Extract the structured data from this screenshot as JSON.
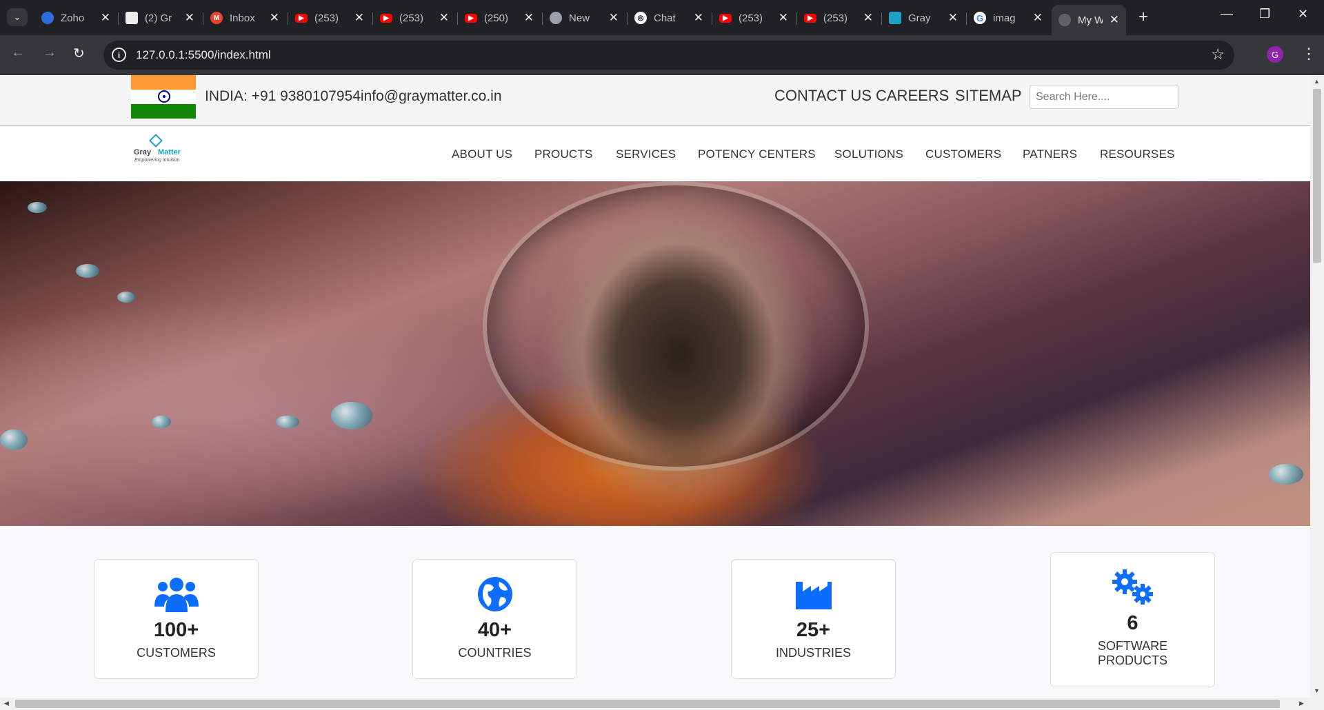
{
  "browser": {
    "tabs": [
      {
        "title": "Zoho",
        "fav_color": "#2d6cdf",
        "icon": "zoho-icon"
      },
      {
        "title": "(2) Gr",
        "fav_color": "#eeeeee",
        "icon": "notebook-icon"
      },
      {
        "title": "Inbox",
        "fav_color": "#ea4335",
        "icon": "gmail-icon"
      },
      {
        "title": "(253)",
        "fav_color": "#ff0000",
        "icon": "youtube-icon"
      },
      {
        "title": "(253)",
        "fav_color": "#ff0000",
        "icon": "youtube-icon"
      },
      {
        "title": "(250)",
        "fav_color": "#ff0000",
        "icon": "youtube-icon"
      },
      {
        "title": "New",
        "fav_color": "#9aa0a6",
        "icon": "chrome-icon"
      },
      {
        "title": "Chat",
        "fav_color": "#ffffff",
        "icon": "chatgpt-icon"
      },
      {
        "title": "(253)",
        "fav_color": "#ff0000",
        "icon": "youtube-icon"
      },
      {
        "title": "(253)",
        "fav_color": "#ff0000",
        "icon": "youtube-icon"
      },
      {
        "title": "Gray",
        "fav_color": "#1ca0c4",
        "icon": "graymatter-icon"
      },
      {
        "title": "imag",
        "fav_color": "#4285f4",
        "icon": "google-icon"
      },
      {
        "title": "My W",
        "fav_color": "#5f6368",
        "icon": "globe-icon"
      }
    ],
    "url": "127.0.0.1:5500/index.html",
    "profile_initial": "G"
  },
  "topbar": {
    "contact_text": "INDIA: +91 9380107954info@graymatter.co.in",
    "links": [
      "CONTACT US",
      "CAREERS",
      "SITEMAP"
    ],
    "search_placeholder": "Search Here...."
  },
  "logo": {
    "word1": "Gray",
    "word2": "Matter",
    "tagline": "Empowering Intuition"
  },
  "nav": [
    "ABOUT US",
    "PROUCTS",
    "SERVICES",
    "POTENCY CENTERS",
    "SOLUTIONS",
    "CUSTOMERS",
    "PATNERS",
    "RESOURSES"
  ],
  "stats": [
    {
      "number": "100+",
      "label": "CUSTOMERS",
      "icon": "users-icon"
    },
    {
      "number": "40+",
      "label": "COUNTRIES",
      "icon": "globe-icon"
    },
    {
      "number": "25+",
      "label": "INDUSTRIES",
      "icon": "industry-icon"
    },
    {
      "number": "6",
      "label": "SOFTWARE PRODUCTS",
      "icon": "gears-icon"
    }
  ],
  "colors": {
    "accent": "#0d6efd",
    "text": "#333333"
  }
}
